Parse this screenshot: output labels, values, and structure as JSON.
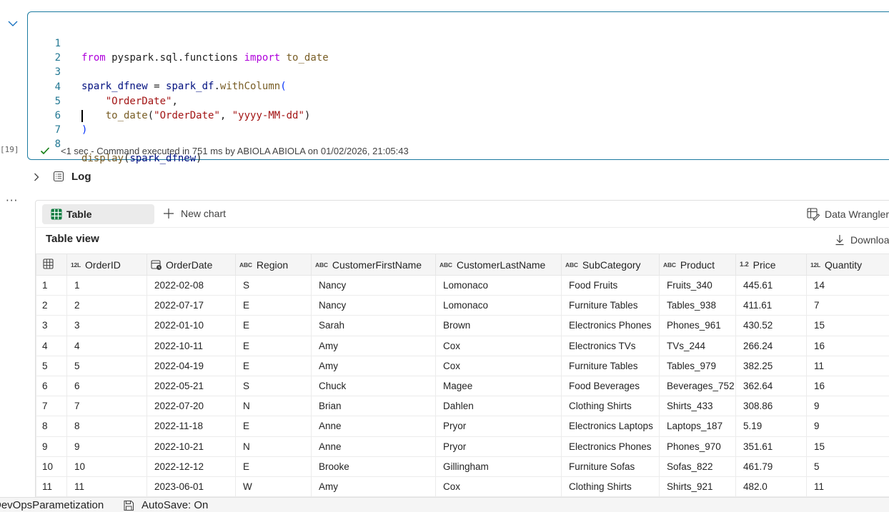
{
  "cell": {
    "execution_count": "[19]",
    "code_lines": [
      {
        "num": "1"
      },
      {
        "num": "2"
      },
      {
        "num": "3"
      },
      {
        "num": "4"
      },
      {
        "num": "5"
      },
      {
        "num": "6"
      },
      {
        "num": "7"
      },
      {
        "num": "8"
      }
    ],
    "code": {
      "l1_from": "from",
      "l1_module": "pyspark.sql.functions",
      "l1_import": "import",
      "l1_name": "to_date",
      "l3_var": "spark_dfnew",
      "l3_eq": " = ",
      "l3_obj": "spark_df",
      "l3_dot": ".",
      "l3_method": "withColumn",
      "l3_open": "(",
      "l4_str": "\"OrderDate\"",
      "l4_comma": ",",
      "l5_fn": "to_date",
      "l5_open": "(",
      "l5_arg1": "\"OrderDate\"",
      "l5_sep": ", ",
      "l5_arg2": "\"yyyy-MM-dd\"",
      "l5_close": ")",
      "l6_close": ")",
      "l8_fn": "display",
      "l8_open": "(",
      "l8_arg": "spark_dfnew",
      "l8_close": ")"
    },
    "status_text": "<1 sec - Command executed in 751 ms by ABIOLA ABIOLA on 01/02/2026, 21:05:43"
  },
  "log": {
    "label": "Log"
  },
  "output": {
    "tabs": {
      "table_label": "Table",
      "new_chart_label": "New chart"
    },
    "data_wrangler_label": "Data Wrangler",
    "table_view_title": "Table view",
    "download_label": "Download",
    "columns": [
      {
        "type": "12L",
        "label": "OrderID"
      },
      {
        "type": "date",
        "label": "OrderDate"
      },
      {
        "type": "ABC",
        "label": "Region"
      },
      {
        "type": "ABC",
        "label": "CustomerFirstName"
      },
      {
        "type": "ABC",
        "label": "CustomerLastName"
      },
      {
        "type": "ABC",
        "label": "SubCategory"
      },
      {
        "type": "ABC",
        "label": "Product"
      },
      {
        "type": "1.2",
        "label": "Price"
      },
      {
        "type": "12L",
        "label": "Quantity"
      }
    ],
    "rows": [
      [
        "1",
        "1",
        "2022-02-08",
        "S",
        "Nancy",
        "Lomonaco",
        "Food Fruits",
        "Fruits_340",
        "445.61",
        "14"
      ],
      [
        "2",
        "2",
        "2022-07-17",
        "E",
        "Nancy",
        "Lomonaco",
        "Furniture Tables",
        "Tables_938",
        "411.61",
        "7"
      ],
      [
        "3",
        "3",
        "2022-01-10",
        "E",
        "Sarah",
        "Brown",
        "Electronics Phones",
        "Phones_961",
        "430.52",
        "15"
      ],
      [
        "4",
        "4",
        "2022-10-11",
        "E",
        "Amy",
        "Cox",
        "Electronics TVs",
        "TVs_244",
        "266.24",
        "16"
      ],
      [
        "5",
        "5",
        "2022-04-19",
        "E",
        "Amy",
        "Cox",
        "Furniture Tables",
        "Tables_979",
        "382.25",
        "11"
      ],
      [
        "6",
        "6",
        "2022-05-21",
        "S",
        "Chuck",
        "Magee",
        "Food Beverages",
        "Beverages_752",
        "362.64",
        "16"
      ],
      [
        "7",
        "7",
        "2022-07-20",
        "N",
        "Brian",
        "Dahlen",
        "Clothing Shirts",
        "Shirts_433",
        "308.86",
        "9"
      ],
      [
        "8",
        "8",
        "2022-11-18",
        "E",
        "Anne",
        "Pryor",
        "Electronics Laptops",
        "Laptops_187",
        "5.19",
        "9"
      ],
      [
        "9",
        "9",
        "2022-10-21",
        "N",
        "Anne",
        "Pryor",
        "Electronics Phones",
        "Phones_970",
        "351.61",
        "15"
      ],
      [
        "10",
        "10",
        "2022-12-12",
        "E",
        "Brooke",
        "Gillingham",
        "Furniture Sofas",
        "Sofas_822",
        "461.79",
        "5"
      ],
      [
        "11",
        "11",
        "2023-06-01",
        "W",
        "Amy",
        "Cox",
        "Clothing Shirts",
        "Shirts_921",
        "482.0",
        "11"
      ]
    ]
  },
  "statusbar": {
    "notebook_name": "DevOpsParametization",
    "autosave_label": "AutoSave: On"
  }
}
